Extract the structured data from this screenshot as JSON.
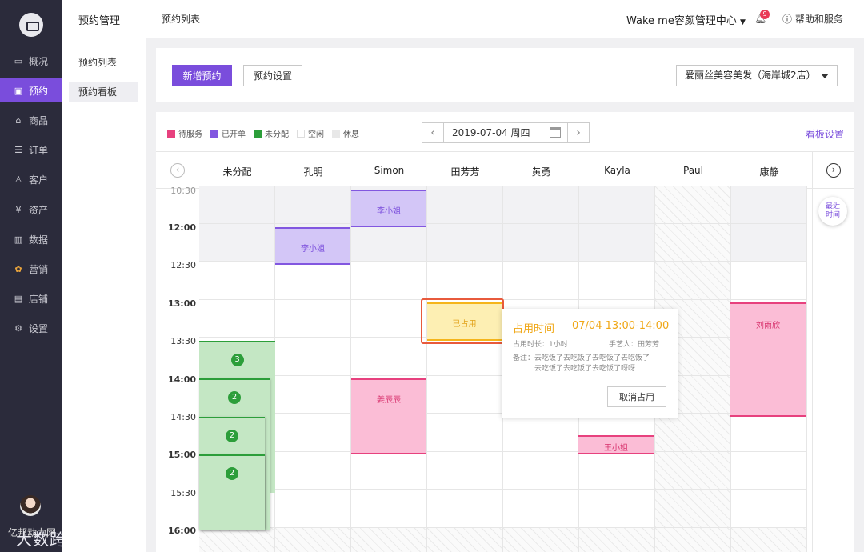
{
  "sidebar": {
    "items": [
      {
        "label": "概况",
        "icon": "monitor-icon"
      },
      {
        "label": "预约",
        "icon": "calendar-icon",
        "active": true
      },
      {
        "label": "商品",
        "icon": "bag-icon"
      },
      {
        "label": "订单",
        "icon": "order-icon"
      },
      {
        "label": "客户",
        "icon": "user-icon"
      },
      {
        "label": "资产",
        "icon": "yen-icon"
      },
      {
        "label": "数据",
        "icon": "chart-icon"
      },
      {
        "label": "营销",
        "icon": "flower-icon"
      },
      {
        "label": "店铺",
        "icon": "shop-icon"
      },
      {
        "label": "设置",
        "icon": "gear-icon"
      }
    ],
    "watermark": "亿邦动力网",
    "brand_watermark": "大数跨境"
  },
  "submenu": {
    "title": "预约管理",
    "items": [
      {
        "label": "预约列表"
      },
      {
        "label": "预约看板",
        "active": true
      }
    ]
  },
  "topbar": {
    "breadcrumb": "预约列表",
    "store": "Wake me容颜管理中心",
    "notification_count": "9",
    "help": "帮助和服务"
  },
  "toolbar": {
    "new_label": "新增预约",
    "settings_label": "预约设置",
    "store_select": "爱丽丝美容美发（海岸城2店）"
  },
  "legend": [
    {
      "label": "待服务",
      "color": "#e7417e"
    },
    {
      "label": "已开单",
      "color": "#8257e0"
    },
    {
      "label": "未分配",
      "color": "#2c9e3a"
    },
    {
      "label": "空闲",
      "color": "#ffffff"
    },
    {
      "label": "休息",
      "color": "#e8e8e8"
    }
  ],
  "date": "2019-07-04 周四",
  "board_settings": "看板设置",
  "columns": [
    "未分配",
    "孔明",
    "Simon",
    "田芳芳",
    "黄勇",
    "Kayla",
    "Paul",
    "康静"
  ],
  "recent_label": "最近时间",
  "times": [
    "10:30",
    "12:00",
    "12:30",
    "13:00",
    "13:30",
    "14:00",
    "14:30",
    "15:00",
    "15:30",
    "16:00"
  ],
  "appointments": {
    "li1": "李小姐",
    "li2": "李小姐",
    "jiang": "姜辰辰",
    "wang": "王小姐",
    "liu": "刘雨欣",
    "g1": "3",
    "g2": "2",
    "g3": "2",
    "g4": "2"
  },
  "occupied": {
    "label": "已占用"
  },
  "popup": {
    "title": "占用时间",
    "time": "07/04 13:00-14:00",
    "duration": "占用时长：1小时",
    "artist": "手艺人：田芳芳",
    "note": "备注：去吃饭了去吃饭了去吃饭了去吃饭了\n　　　去吃饭了去吃饭了去吃饭了呀呀",
    "cancel_label": "取消占用"
  }
}
